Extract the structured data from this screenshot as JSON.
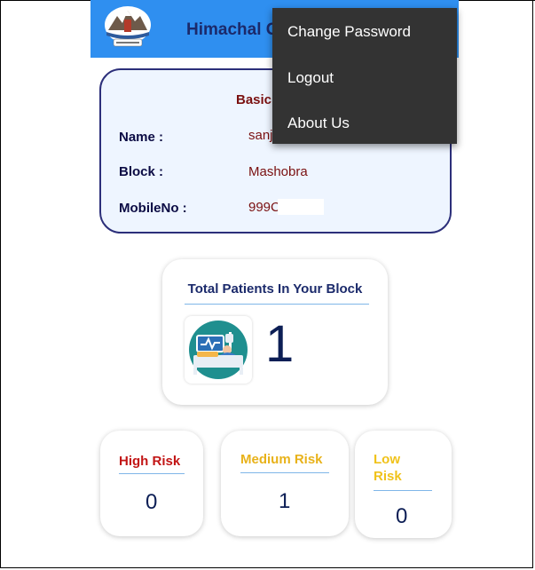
{
  "app_bar": {
    "title": "Himachal C",
    "background": "#2f8ff0"
  },
  "info_card": {
    "title": "Basic",
    "fields": [
      {
        "label": "Name :",
        "value": "sanj"
      },
      {
        "label": "Block :",
        "value": "Mashobra"
      },
      {
        "label": "MobileNo :",
        "value": "999C"
      }
    ]
  },
  "menu": {
    "items": [
      "Change Password",
      "Logout",
      "About Us"
    ]
  },
  "total_card": {
    "title": "Total Patients In Your Block",
    "value": "1",
    "icon": "patient-bed-icon"
  },
  "risk": {
    "high": {
      "label": "High Risk",
      "value": "0",
      "color": "#c21515"
    },
    "medium": {
      "label": "Medium Risk",
      "value": "1",
      "color": "#e8b21a"
    },
    "low": {
      "label_line1": "Low",
      "label_line2": "Risk",
      "value": "0",
      "color": "#f0c21a"
    }
  }
}
